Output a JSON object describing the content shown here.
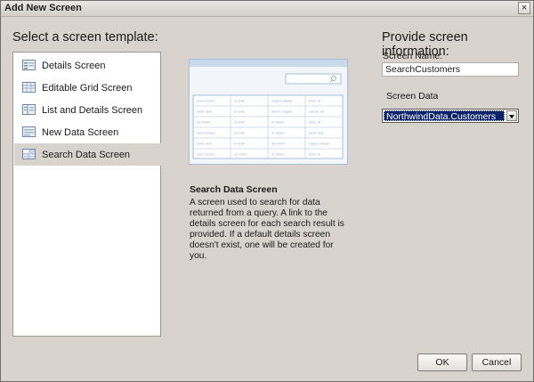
{
  "window": {
    "title": "Add New Screen",
    "close_glyph": "×"
  },
  "left": {
    "heading": "Select a screen template:",
    "templates": [
      {
        "label": "Details Screen",
        "icon": "details-screen-icon",
        "selected": false
      },
      {
        "label": "Editable Grid Screen",
        "icon": "grid-screen-icon",
        "selected": false
      },
      {
        "label": "List and Details Screen",
        "icon": "list-details-screen-icon",
        "selected": false
      },
      {
        "label": "New Data Screen",
        "icon": "new-data-screen-icon",
        "selected": false
      },
      {
        "label": "Search Data Screen",
        "icon": "search-data-screen-icon",
        "selected": true
      }
    ]
  },
  "middle": {
    "preview_rows": [
      [
        "lorem ipsum",
        "et enim",
        "magna aliqua",
        "dolor sit"
      ],
      [
        "amet duis",
        "et enim",
        "dolore magna",
        "sed do eiu"
      ],
      [
        "ad minim",
        "et enim",
        "ut dolore",
        "dolor sit"
      ],
      [
        "lorem ipsum",
        "et enim",
        "ut dolore",
        "amet duis"
      ],
      [
        "amet duis",
        "et enim",
        "ad minim",
        "magna aliqua"
      ],
      [
        "lorem ipsum",
        "ad minim",
        "ut dolore",
        "dolor sit"
      ]
    ],
    "description_title": "Search Data Screen",
    "description": "A screen used to search for data returned from a query.  A link to the details screen for each search result is provided.  If a default details screen doesn't exist, one will be created for you."
  },
  "right": {
    "heading": "Provide screen information:",
    "screen_name_label": "Screen Name:",
    "screen_name_value": "SearchCustomers",
    "screen_data_label": "Screen Data",
    "screen_data_value": "NorthwindData.Customers"
  },
  "buttons": {
    "ok": "OK",
    "cancel": "Cancel"
  },
  "colors": {
    "selection": "#0a246a",
    "dialog_bg": "#d8d4cd",
    "preview_accent": "#a8bdd6"
  }
}
